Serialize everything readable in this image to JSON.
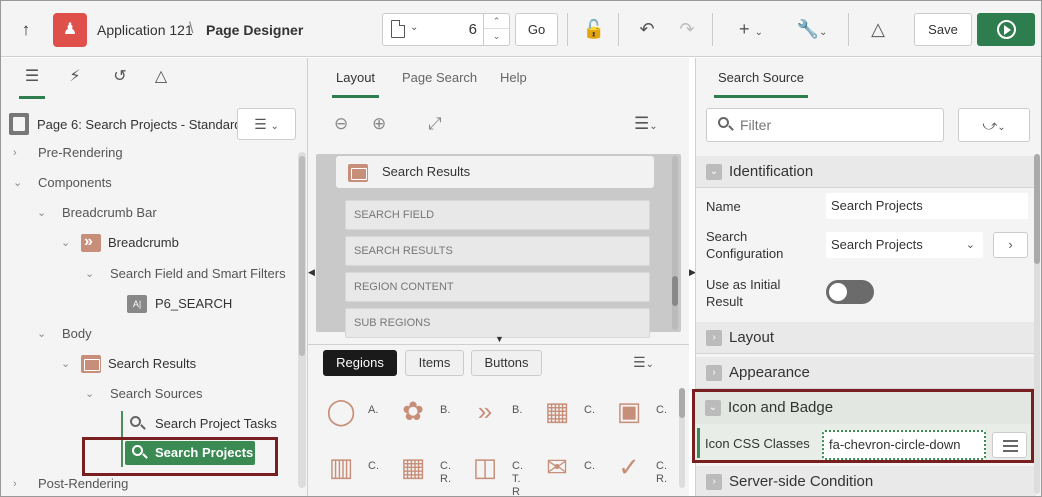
{
  "header": {
    "app_name": "Application 121",
    "separator": "\\",
    "page_designer": "Page Designer",
    "page_number": "6",
    "go_label": "Go",
    "save_label": "Save"
  },
  "left_panel": {
    "page_label": "Page 6: Search Projects - Standard",
    "tree": {
      "pre_rendering": "Pre-Rendering",
      "components": "Components",
      "breadcrumb_bar": "Breadcrumb Bar",
      "breadcrumb": "Breadcrumb",
      "search_field_filters": "Search Field and Smart Filters",
      "p6_search": "P6_SEARCH",
      "body": "Body",
      "search_results": "Search Results",
      "search_sources": "Search Sources",
      "search_project_tasks": "Search Project Tasks",
      "search_projects": "Search Projects",
      "post_rendering": "Post-Rendering"
    }
  },
  "middle_panel": {
    "tabs": [
      "Layout",
      "Page Search",
      "Help"
    ],
    "region_title": "Search Results",
    "slots": [
      "SEARCH FIELD",
      "SEARCH RESULTS",
      "REGION CONTENT",
      "SUB REGIONS"
    ],
    "gallery_tabs": [
      "Regions",
      "Items",
      "Buttons"
    ],
    "gallery_items": [
      {
        "label": "A."
      },
      {
        "label": "B."
      },
      {
        "label": "B."
      },
      {
        "label": "C."
      },
      {
        "label": "C."
      },
      {
        "label": "C."
      },
      {
        "label": "C.\nR."
      },
      {
        "label": "C.\nT.\nR"
      },
      {
        "label": "C."
      },
      {
        "label": "C.\nR."
      }
    ]
  },
  "right_panel": {
    "tab": "Search Source",
    "filter_placeholder": "Filter",
    "identification": {
      "title": "Identification",
      "name_label": "Name",
      "name_value": "Search Projects",
      "search_config_label": "Search Configuration",
      "search_config_value": "Search Projects",
      "initial_result_label": "Use as Initial Result"
    },
    "layout_title": "Layout",
    "appearance_title": "Appearance",
    "icon_badge": {
      "title": "Icon and Badge",
      "icon_css_label": "Icon CSS Classes",
      "icon_css_value": "fa-chevron-circle-down"
    },
    "server_side_title": "Server-side Condition"
  }
}
